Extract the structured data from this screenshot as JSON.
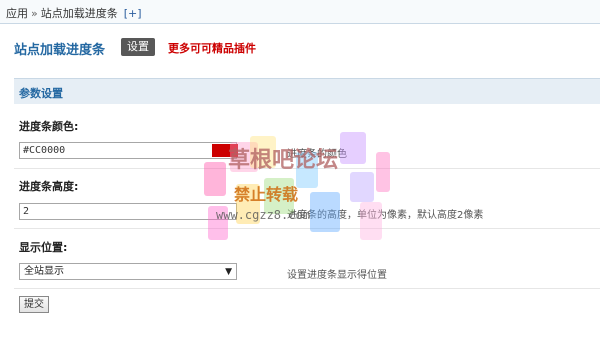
{
  "breadcrumb": {
    "root": "应用",
    "separator": "»",
    "current": "站点加载进度条",
    "add_label": "[+]"
  },
  "header": {
    "title": "站点加载进度条",
    "settings_tab": "设置",
    "more_link": "更多可可精品插件"
  },
  "section": {
    "title": "参数设置"
  },
  "fields": {
    "color": {
      "label": "进度条颜色:",
      "value": "#CC0000",
      "tip": "进度条的颜色",
      "swatch_color": "#CC0000"
    },
    "height": {
      "label": "进度条高度:",
      "value": "2",
      "tip": "进度条的高度，单位为像素，默认高度2像素"
    },
    "position": {
      "label": "显示位置:",
      "selected": "全站显示",
      "tip": "设置进度条显示得位置"
    }
  },
  "submit_label": "提交",
  "watermark": {
    "main": "草根吧论坛",
    "sub": "禁止转载",
    "url": "www.cgzz8.com"
  },
  "colors": {
    "accent": "#2468a2",
    "alert_red": "#cc0000",
    "section_bg": "#e6eef5"
  }
}
